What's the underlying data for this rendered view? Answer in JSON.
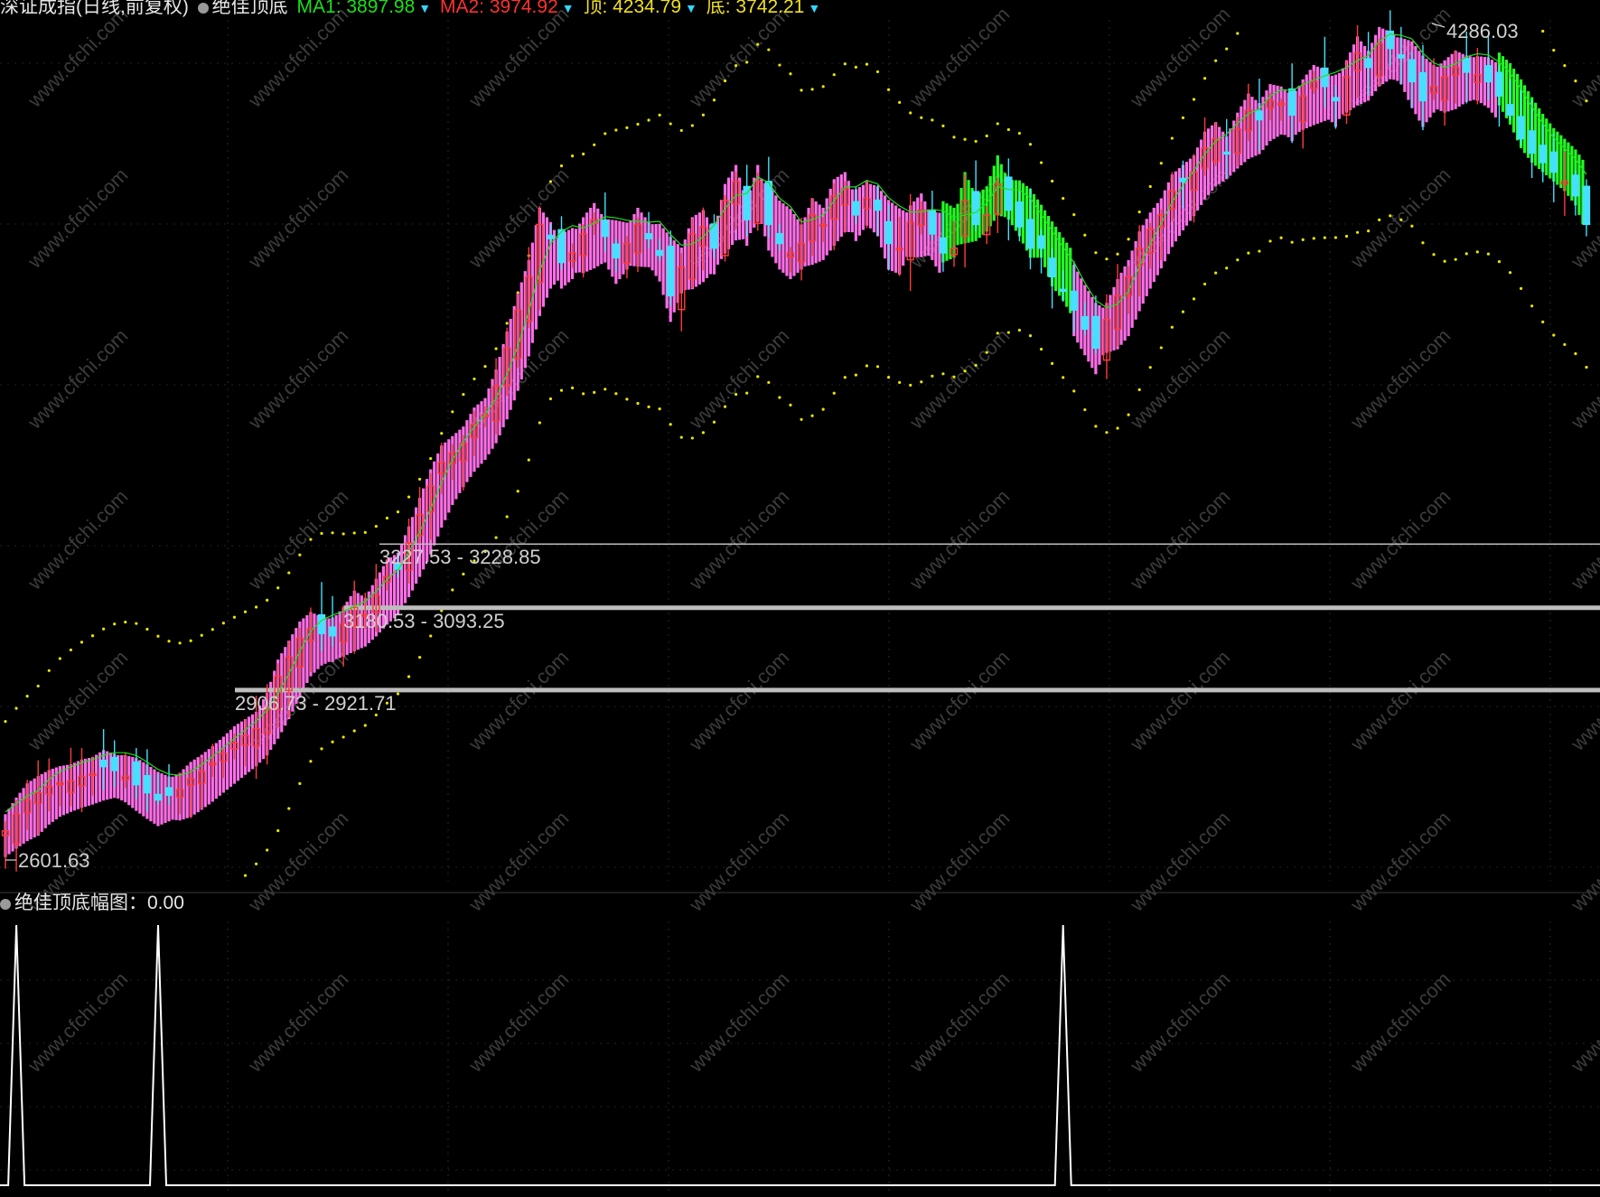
{
  "header": {
    "symbol_label": "深证成指(日线,前复权)",
    "indicator_name": "绝佳顶底",
    "ma1_label": "MA1: 3897.98",
    "ma2_label": "MA2: 3974.92",
    "top_label": "顶: 4234.79",
    "bottom_label": "底: 3742.21",
    "colors": {
      "text": "#e6e6e6",
      "ma1": "#19e019",
      "ma2": "#ff3030",
      "top": "#f0e020",
      "bottom": "#f0e020",
      "arrow": "#33d6ff"
    }
  },
  "sub_header": {
    "title": "绝佳顶底幅图：0.00"
  },
  "watermark_text": "www.cfchi.com",
  "chart_data": [
    {
      "type": "candlestick",
      "panel": "main",
      "title": "",
      "colors": {
        "up": "#ff3b3b",
        "down": "#46e0ff",
        "bull_band": "#ff6ee8",
        "bear_band": "#22ff22",
        "envelope": "#e6e600",
        "hline": "#bdbdbd",
        "label": "#d0d0d0"
      },
      "ylim": [
        2520,
        4330
      ],
      "high_label": "4286.03",
      "low_label": "2601.63",
      "close": [
        2625,
        2660,
        2690,
        2705,
        2718,
        2726,
        2730,
        2740,
        2745,
        2760,
        2752,
        2740,
        2722,
        2705,
        2690,
        2700,
        2712,
        2735,
        2750,
        2768,
        2788,
        2810,
        2825,
        2840,
        2880,
        2950,
        2990,
        3030,
        3050,
        3040,
        3035,
        3060,
        3095,
        3080,
        3120,
        3160,
        3175,
        3230,
        3290,
        3350,
        3400,
        3420,
        3440,
        3480,
        3500,
        3560,
        3640,
        3720,
        3790,
        3900,
        3870,
        3820,
        3840,
        3880,
        3910,
        3875,
        3830,
        3860,
        3900,
        3870,
        3835,
        3750,
        3810,
        3880,
        3895,
        3850,
        3950,
        3990,
        3910,
        3990,
        3900,
        3860,
        3840,
        3860,
        3920,
        3900,
        3960,
        3975,
        3920,
        3955,
        3930,
        3860,
        3850,
        3905,
        3930,
        3880,
        3840,
        3850,
        3950,
        3900,
        3920,
        3985,
        3930,
        3895,
        3850,
        3850,
        3790,
        3760,
        3720,
        3680,
        3640,
        3700,
        3750,
        3790,
        3850,
        3890,
        3920,
        3970,
        3990,
        4010,
        4060,
        4080,
        4050,
        4100,
        4140,
        4120,
        4160,
        4155,
        4130,
        4170,
        4200,
        4190,
        4160,
        4210,
        4260,
        4230,
        4280,
        4270,
        4250,
        4200,
        4160,
        4190,
        4210,
        4230,
        4220,
        4215,
        4200,
        4170,
        4130,
        4080,
        4050,
        4030,
        4010,
        3990,
        3960,
        3900
      ],
      "high_label_index": 131,
      "low_label_index": 0,
      "trend": [
        1,
        1,
        1,
        1,
        1,
        1,
        1,
        1,
        1,
        1,
        1,
        1,
        1,
        1,
        1,
        1,
        1,
        1,
        1,
        1,
        1,
        1,
        1,
        1,
        1,
        1,
        1,
        1,
        1,
        1,
        1,
        1,
        1,
        1,
        1,
        1,
        1,
        1,
        1,
        1,
        1,
        1,
        1,
        1,
        1,
        1,
        1,
        1,
        1,
        1,
        1,
        1,
        1,
        1,
        1,
        1,
        1,
        1,
        1,
        1,
        1,
        1,
        1,
        1,
        1,
        1,
        1,
        1,
        1,
        1,
        1,
        1,
        1,
        1,
        1,
        1,
        1,
        1,
        1,
        1,
        1,
        1,
        1,
        1,
        1,
        1,
        -1,
        -1,
        -1,
        -1,
        -1,
        -1,
        -1,
        -1,
        -1,
        -1,
        -1,
        -1,
        1,
        1,
        1,
        1,
        1,
        1,
        1,
        1,
        1,
        1,
        1,
        1,
        1,
        1,
        1,
        1,
        1,
        1,
        1,
        1,
        1,
        1,
        1,
        1,
        1,
        1,
        1,
        1,
        1,
        1,
        1,
        1,
        1,
        1,
        1,
        1,
        1,
        1,
        1,
        -1,
        -1,
        -1,
        -1,
        -1,
        -1,
        -1,
        -1,
        -1,
        -1,
        -1,
        -1
      ],
      "price_levels": [
        {
          "label": "3227.53 - 3228.85",
          "value": 3228
        },
        {
          "label": "3180.53 - 3093.25",
          "value": 3094
        },
        {
          "label": "2906.73 - 2921.71",
          "value": 2921
        }
      ]
    },
    {
      "type": "line",
      "panel": "sub",
      "title": "绝佳顶底幅图",
      "ylim": [
        0,
        1
      ],
      "spikes": [
        {
          "index": 1,
          "value": 1
        },
        {
          "index": 14,
          "value": 1
        },
        {
          "index": 97,
          "value": 1
        }
      ]
    }
  ]
}
